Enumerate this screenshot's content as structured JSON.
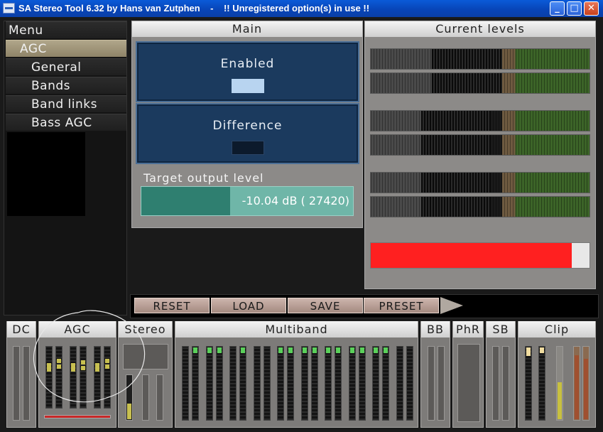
{
  "window": {
    "title": "SA Stereo Tool 6.32 by Hans van Zutphen    -    !! Unregistered option(s) in use !!",
    "buttons": {
      "minimize": "_",
      "maximize": "□",
      "close": "✕"
    }
  },
  "menu": {
    "header": "Menu",
    "items": [
      {
        "label": "AGC",
        "selected": true
      },
      {
        "label": "General"
      },
      {
        "label": "Bands"
      },
      {
        "label": "Band links"
      },
      {
        "label": "Bass AGC"
      }
    ]
  },
  "main": {
    "header": "Main",
    "enabled": {
      "label": "Enabled",
      "state": true
    },
    "difference": {
      "label": "Difference",
      "state": false
    },
    "target": {
      "label": "Target output level",
      "value": "-10.04 dB ( 27420)",
      "fill_fraction": 0.42
    }
  },
  "levels": {
    "header": "Current levels",
    "meters": [
      0.28,
      0.28,
      0.23,
      0.23,
      0.23,
      0.23
    ],
    "clip_fraction": 0.92
  },
  "toolbar": {
    "reset": "RESET",
    "load": "LOAD",
    "save": "SAVE",
    "preset": "PRESET"
  },
  "bottom": {
    "dc": "DC",
    "agc": "AGC",
    "stereo": "Stereo",
    "multiband": "Multiband",
    "bb": "BB",
    "phr": "PhR",
    "sb": "SB",
    "clip": "Clip"
  },
  "colors": {
    "titlebar": "#0a5bd8",
    "panel": "#8c8a88",
    "button_blue": "#1b3a5e",
    "slider_fill": "#2f7f70",
    "clip_red": "#ff2020",
    "meter_green": "#5ad05a"
  }
}
